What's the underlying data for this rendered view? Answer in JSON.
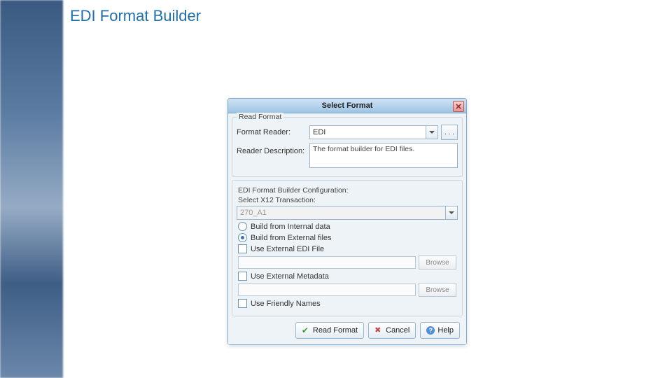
{
  "page": {
    "title": "EDI Format Builder"
  },
  "dialog": {
    "title": "Select Format",
    "read_format_legend": "Read Format",
    "format_reader_label": "Format Reader:",
    "format_reader_value": "EDI",
    "dots": ". . .",
    "reader_description_label": "Reader Description:",
    "reader_description_value": "The format builder for EDI files.",
    "config": {
      "title": "EDI Format Builder Configuration:",
      "select_label": "Select X12 Transaction:",
      "select_value": "270_A1",
      "radio_internal": "Build from Internal data",
      "radio_external": "Build from External files",
      "use_ext_edi": "Use External EDI File",
      "use_ext_meta": "Use External Metadata",
      "use_friendly": "Use Friendly Names",
      "browse": "Browse"
    },
    "buttons": {
      "read": "Read Format",
      "cancel": "Cancel",
      "help": "Help"
    }
  }
}
